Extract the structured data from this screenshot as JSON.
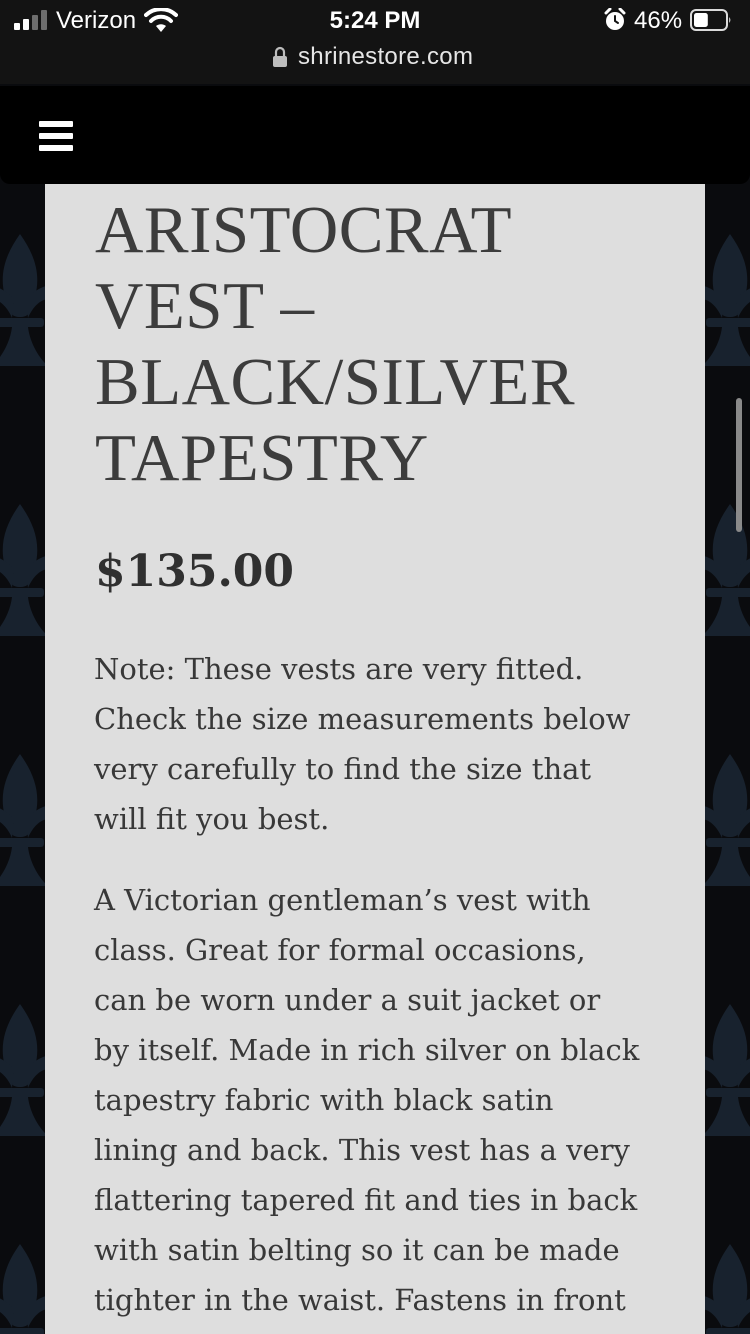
{
  "status_bar": {
    "carrier": "Verizon",
    "time": "5:24 PM",
    "battery_percent": "46%",
    "signal_icon": "cellular-signal-icon",
    "wifi_icon": "wifi-icon",
    "alarm_icon": "alarm-clock-icon",
    "battery_icon": "battery-icon",
    "battery_level": 0.46
  },
  "browser": {
    "url": "shrinestore.com",
    "lock_icon": "lock-icon"
  },
  "header": {
    "menu_icon": "hamburger-menu-icon"
  },
  "product": {
    "title_lines": [
      "ARISTOCRAT",
      "VEST –",
      "BLACK/SILVER",
      "TAPESTRY"
    ],
    "price": "$135.00",
    "note_lines": [
      "Note: These vests are very fitted.",
      "Check the size measurements below",
      "very carefully to find the size that",
      "will fit you best."
    ],
    "description_lines": [
      "A Victorian gentleman’s vest with",
      "class. Great for formal occasions,",
      "can be worn under a suit jacket or",
      "by itself. Made in rich silver on black",
      "tapestry fabric with black satin",
      "lining and back. This vest has a very",
      "flattering tapered fit and ties in back",
      "with satin belting so it can be made",
      "tighter in the waist. Fastens in front"
    ]
  },
  "colors": {
    "page_background": "#0a0b0e",
    "pattern_color": "#1b2633",
    "panel_background": "#dedede",
    "text": "#383838",
    "header_background": "#000000"
  }
}
